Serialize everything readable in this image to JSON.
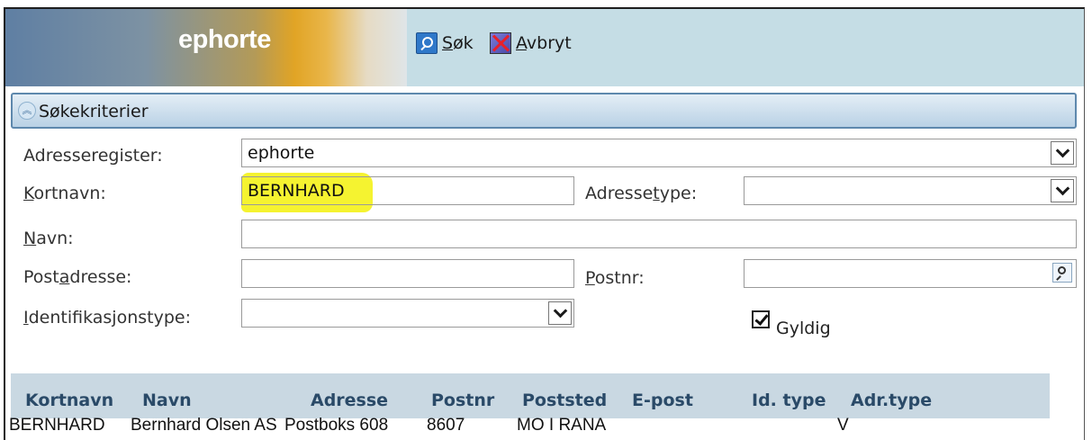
{
  "header": {
    "logo_text": "ephorte",
    "toolbar": {
      "search_key": "S",
      "search_rest": "øk",
      "cancel_key": "A",
      "cancel_rest": "vbryt"
    }
  },
  "section": {
    "title": "Søkekriterier"
  },
  "form": {
    "adresseregister": {
      "label": "Adresseregister:",
      "value": "ephorte"
    },
    "kortnavn": {
      "label_key": "K",
      "label_rest": "ortnavn:",
      "value": "BERNHARD"
    },
    "adressetype": {
      "label_pre": "Adresse",
      "label_key": "t",
      "label_rest": "ype:",
      "value": ""
    },
    "navn": {
      "label_key": "N",
      "label_rest": "avn:",
      "value": ""
    },
    "postadresse": {
      "label_pre": "Post",
      "label_key": "a",
      "label_rest": "dresse:",
      "value": ""
    },
    "postnr": {
      "label_key": "P",
      "label_rest": "ostnr:",
      "value": ""
    },
    "identifikasjonstype": {
      "label_key": "I",
      "label_rest": "dentifikasjonstype:",
      "value": ""
    },
    "gyldig": {
      "label": "Gyldig",
      "checked": true
    }
  },
  "table": {
    "columns": [
      "Kortnavn",
      "Navn",
      "Adresse",
      "Postnr",
      "Poststed",
      "E-post",
      "Id. type",
      "Adr.type"
    ],
    "rows": [
      [
        "BERNHARD",
        "Bernhard Olsen AS",
        "Postboks 608",
        "8607",
        "MO I RANA",
        "",
        "",
        "V"
      ]
    ]
  },
  "colors": {
    "header_bg": "#c5dde5",
    "highlight": "#f4f21a",
    "section_border": "#5e88ad"
  }
}
